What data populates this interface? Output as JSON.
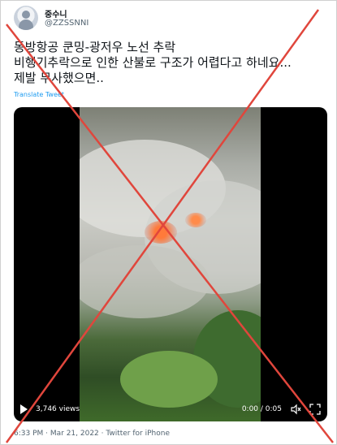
{
  "user": {
    "display_name": "중수니",
    "handle": "@ZZSSNNI"
  },
  "tweet": {
    "lines": [
      "동방항공 쿤밍-광저우 노선 추락",
      "비행기추락으로 인한 산불로 구조가 어렵다고 하네요...",
      "제발 무사했으면.."
    ],
    "translate_label": "Translate Tweet"
  },
  "video": {
    "views": "3,746 views",
    "time": "0:00 / 0:05"
  },
  "meta": {
    "timestamp": "6:33 PM · Mar 21, 2022 · Twitter for iPhone"
  },
  "colors": {
    "overlay_x": "#e0463c",
    "link": "#1d9bf0",
    "secondary_text": "#536471"
  }
}
